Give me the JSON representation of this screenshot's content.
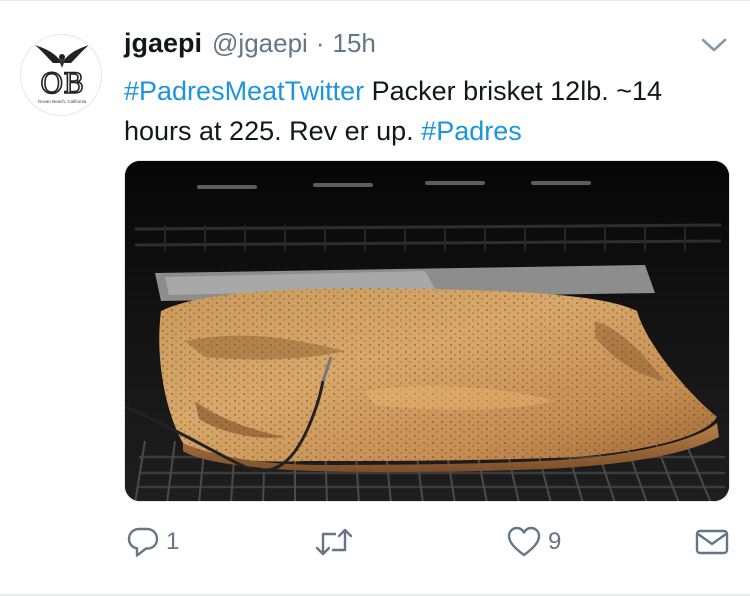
{
  "tweet": {
    "author_name": "jgaepi",
    "handle": "@jgaepi",
    "separator": "·",
    "time": "15h",
    "text": {
      "hashtag1": "#PadresMeatTwitter",
      "body": " Packer brisket 12lb. ~14 hours at 225. Rev er up. ",
      "hashtag2": "#Padres"
    },
    "media": {
      "kind": "photo",
      "subject": "brisket on smoker grill"
    },
    "actions": {
      "reply_count": "1",
      "retweet_count": "",
      "like_count": "9"
    }
  },
  "avatar": {
    "logo_text": "OB",
    "logo_caption": "Ocean Beach, California"
  },
  "colors": {
    "link": "#1b95e0",
    "secondary_text": "#657786",
    "primary_text": "#14171a",
    "border": "#e1e8ed"
  },
  "icons": [
    "chevron-down-icon",
    "reply-icon",
    "retweet-icon",
    "like-icon",
    "direct-message-icon"
  ]
}
